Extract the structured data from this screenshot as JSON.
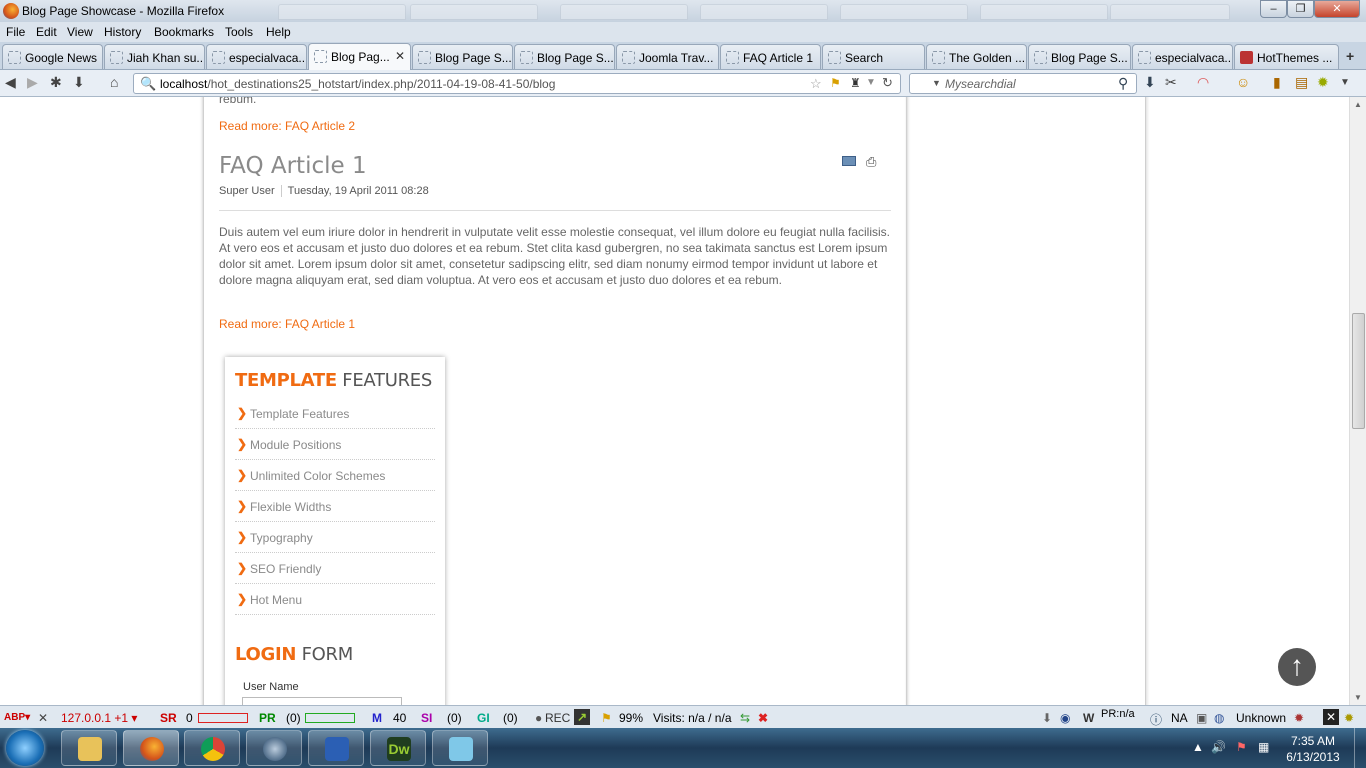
{
  "window": {
    "title": "Blog Page Showcase - Mozilla Firefox",
    "buttons": {
      "minimize": "–",
      "maximize": "❐",
      "close": "✕"
    }
  },
  "menu": [
    "File",
    "Edit",
    "View",
    "History",
    "Bookmarks",
    "Tools",
    "Help"
  ],
  "tabs": [
    {
      "label": "Google News"
    },
    {
      "label": "Jiah Khan su..."
    },
    {
      "label": "especialvaca..."
    },
    {
      "label": "Blog Pag...",
      "active": true
    },
    {
      "label": "Blog Page S..."
    },
    {
      "label": "Blog Page S..."
    },
    {
      "label": "Joomla Trav..."
    },
    {
      "label": "FAQ Article 1"
    },
    {
      "label": "Search"
    },
    {
      "label": "The Golden ..."
    },
    {
      "label": "Blog Page S..."
    },
    {
      "label": "especialvaca..."
    },
    {
      "label": "HotThemes ..."
    }
  ],
  "address": {
    "host": "localhost",
    "path": "/hot_destinations25_hotstart/index.php/2011-04-19-08-41-50/blog"
  },
  "search": {
    "placeholder": "Mysearchdial"
  },
  "content": {
    "prev_tail": "rebum.",
    "prev_readmore": "Read more: FAQ Article 2",
    "article": {
      "title": "FAQ Article 1",
      "author": "Super User",
      "date": "Tuesday, 19 April 2011 08:28",
      "body": "Duis autem vel eum iriure dolor in hendrerit in vulputate velit esse molestie consequat, vel illum dolore eu feugiat nulla facilisis. At vero eos et accusam et justo duo dolores et ea rebum. Stet clita kasd gubergren, no sea takimata sanctus est Lorem ipsum dolor sit amet. Lorem ipsum dolor sit amet, consetetur sadipscing elitr, sed diam nonumy eirmod tempor invidunt ut labore et dolore magna aliquyam erat, sed diam voluptua. At vero eos et accusam et justo duo dolores et ea rebum.",
      "readmore": "Read more: FAQ Article 1"
    }
  },
  "features_module": {
    "title_accent": "TEMPLATE",
    "title_rest": " FEATURES",
    "items": [
      "Template Features",
      "Module Positions",
      "Unlimited Color Schemes",
      "Flexible Widths",
      "Typography",
      "SEO Friendly",
      "Hot Menu"
    ]
  },
  "login_module": {
    "title_accent": "LOGIN",
    "title_rest": " FORM",
    "username_label": "User Name"
  },
  "addon_bar": {
    "ip": "127.0.0.1 +1 ▾",
    "sr": "SR",
    "sr_val": "0",
    "pr": "PR",
    "pr_val": "(0)",
    "m": "M",
    "m_val": "40",
    "si": "SI",
    "si_val": "(0)",
    "gi": "GI",
    "gi_val": "(0)",
    "rec": "REC",
    "pct": "99%",
    "visits": "Visits: n/a / n/a",
    "prn": "PR:n/a",
    "na": "NA",
    "unknown": "Unknown"
  },
  "clock": {
    "time": "7:35 AM",
    "date": "6/13/2013"
  },
  "colors": {
    "accent": "#f06b12",
    "text": "#666666"
  }
}
